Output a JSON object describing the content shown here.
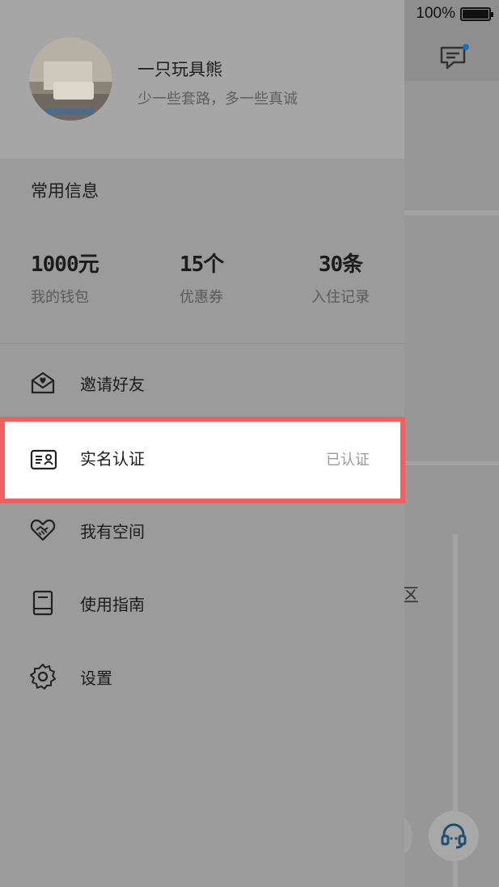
{
  "status_bar": {
    "battery_text": "100%"
  },
  "profile": {
    "username": "一只玩具熊",
    "motto": "少一些套路，多一些真诚"
  },
  "common_info": {
    "title": "常用信息",
    "stats": [
      {
        "value": "1000元",
        "label": "我的钱包"
      },
      {
        "value": "15个",
        "label": "优惠券"
      },
      {
        "value": "30条",
        "label": "入住记录"
      }
    ]
  },
  "menu": {
    "invite": {
      "label": "邀请好友",
      "icon": "invite-envelope-heart-icon"
    },
    "verify": {
      "label": "实名认证",
      "status": "已认证",
      "icon": "id-card-icon"
    },
    "space": {
      "label": "我有空间",
      "icon": "handshake-heart-icon"
    },
    "guide": {
      "label": "使用指南",
      "icon": "guide-book-icon"
    },
    "settings": {
      "label": "设置",
      "icon": "gear-icon"
    }
  },
  "background": {
    "map_label": "区"
  },
  "colors": {
    "highlight_border": "#f06060",
    "accent_dot": "#1a73b8"
  }
}
